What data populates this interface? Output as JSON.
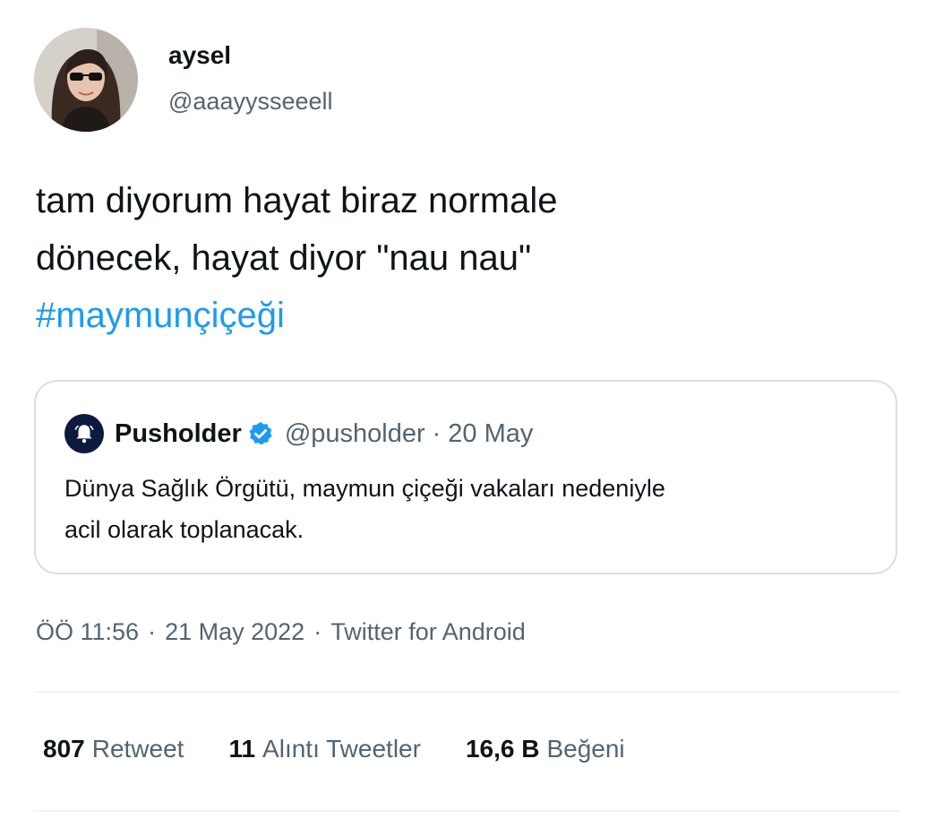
{
  "tweet": {
    "author": {
      "display_name": "aysel",
      "handle": "@aaayysseeell"
    },
    "text_lines": [
      "tam diyorum hayat biraz normale",
      "dönecek, hayat diyor \"nau nau\""
    ],
    "hashtag": "#maymunçiçeği",
    "timestamp": {
      "time": "ÖÖ 11:56",
      "separator": "·",
      "date": "21 May 2022",
      "source": "Twitter for Android"
    },
    "stats": [
      {
        "count": "807",
        "label": "Retweet"
      },
      {
        "count": "11",
        "label": "Alıntı Tweetler"
      },
      {
        "count": "16,6 B",
        "label": "Beğeni"
      }
    ]
  },
  "quoted_tweet": {
    "display_name": "Pusholder",
    "handle": "@pusholder",
    "separator": "·",
    "date": "20 May",
    "text_lines": [
      "Dünya Sağlık Örgütü, maymun çiçeği vakaları nedeniyle",
      "acil olarak toplanacak."
    ]
  },
  "colors": {
    "text": "#0f1419",
    "secondary": "#536471",
    "accent": "#1d9bf0",
    "border": "#d9dee2",
    "divider": "#eff3f4"
  },
  "icons": {
    "avatar": "profile-photo",
    "quote_avatar": "bell-icon",
    "verified": "verified-badge-icon"
  }
}
